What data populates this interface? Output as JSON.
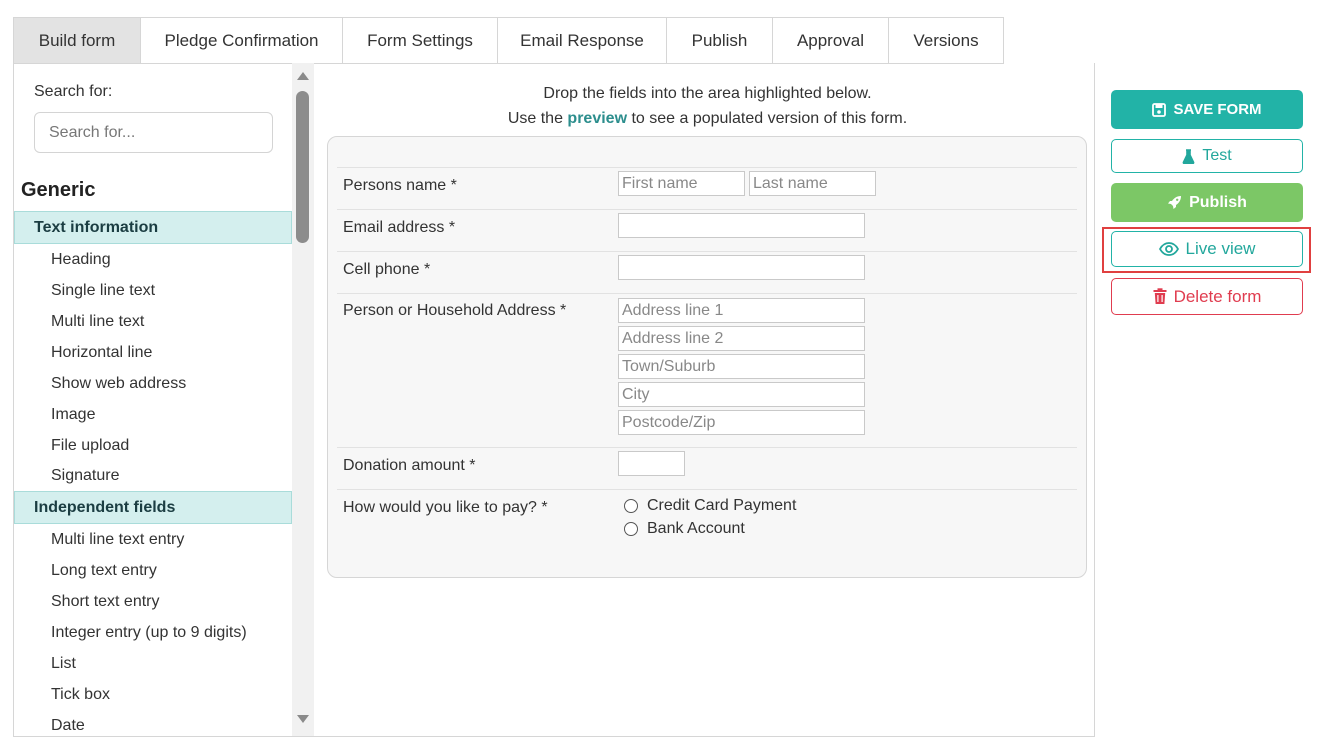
{
  "tabs": [
    {
      "label": "Build form",
      "active": true
    },
    {
      "label": "Pledge Confirmation",
      "active": false
    },
    {
      "label": "Form Settings",
      "active": false
    },
    {
      "label": "Email Response",
      "active": false
    },
    {
      "label": "Publish",
      "active": false
    },
    {
      "label": "Approval",
      "active": false
    },
    {
      "label": "Versions",
      "active": false
    }
  ],
  "sidebar": {
    "search_label": "Search for:",
    "search_placeholder": "Search for...",
    "group_title": "Generic",
    "categories": [
      {
        "title": "Text information",
        "items": [
          "Heading",
          "Single line text",
          "Multi line text",
          "Horizontal line",
          "Show web address",
          "Image",
          "File upload",
          "Signature"
        ]
      },
      {
        "title": "Independent fields",
        "items": [
          "Multi line text entry",
          "Long text entry",
          "Short text entry",
          "Integer entry (up to 9 digits)",
          "List",
          "Tick box",
          "Date"
        ]
      }
    ]
  },
  "canvas": {
    "instruction_line1": "Drop the fields into the area highlighted below.",
    "instruction_pre": "Use the ",
    "instruction_link": "preview",
    "instruction_post": " to see a populated version of this form.",
    "fields": {
      "name_label": "Persons name *",
      "first_name_placeholder": "First name",
      "last_name_placeholder": "Last name",
      "email_label": "Email address *",
      "cell_label": "Cell phone *",
      "address_label": "Person or Household Address *",
      "address_placeholders": [
        "Address line 1",
        "Address line 2",
        "Town/Suburb",
        "City",
        "Postcode/Zip"
      ],
      "donation_label": "Donation amount *",
      "pay_label": "How would you like to pay? *",
      "pay_options": [
        "Credit Card Payment",
        "Bank Account"
      ]
    }
  },
  "actions": {
    "save": "SAVE FORM",
    "test": "Test",
    "publish": "Publish",
    "live_view": "Live view",
    "delete": "Delete form"
  },
  "colors": {
    "teal": "#22b3a7",
    "green": "#7cc766",
    "red": "#e03c4f",
    "highlight": "#e04040"
  }
}
